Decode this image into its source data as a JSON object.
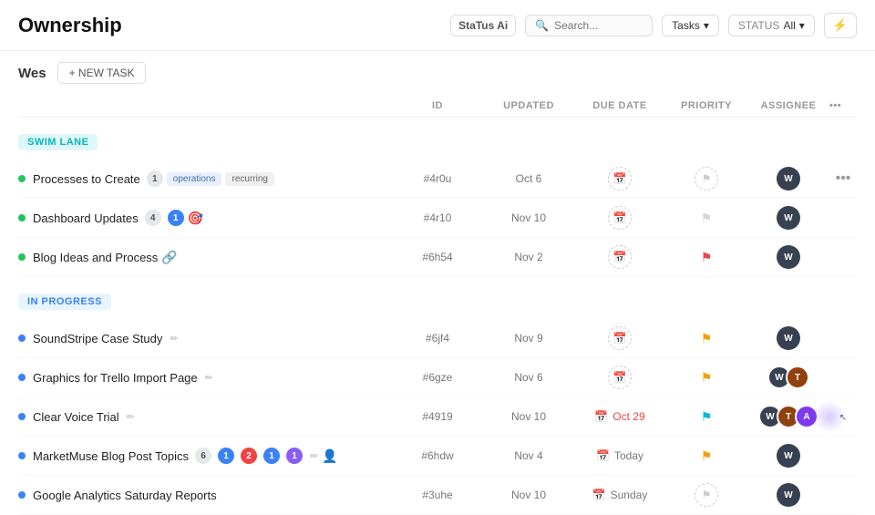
{
  "header": {
    "title": "Ownership",
    "search_placeholder": "Search...",
    "tasks_label": "Tasks",
    "status_label": "STATUS",
    "status_value": "All",
    "ai_label": "StaTus Ai"
  },
  "user": {
    "name": "Wes",
    "new_task_label": "+ NEW TASK"
  },
  "table": {
    "columns": [
      "",
      "ID",
      "UPDATED",
      "DUE DATE",
      "PRIORITY",
      "ASSIGNEE",
      "..."
    ]
  },
  "swim_lane": {
    "label": "SWIM LANE",
    "tasks": [
      {
        "name": "Processes to Create",
        "badge": "1",
        "badge_type": "gray",
        "tags": [
          "operations",
          "recurring"
        ],
        "id": "#4r0u",
        "updated": "Oct 6",
        "due_date": "",
        "priority": "none",
        "assignee": "dark"
      },
      {
        "name": "Dashboard Updates",
        "badge": "4",
        "badge_type": "gray",
        "badge2": "1",
        "badge2_type": "blue",
        "tags": [],
        "id": "#4r10",
        "updated": "Nov 10",
        "due_date": "",
        "priority": "none",
        "assignee": "dark"
      },
      {
        "name": "Blog Ideas and Process",
        "badge": "",
        "tags": [],
        "id": "#6h54",
        "updated": "Nov 2",
        "due_date": "",
        "priority": "red",
        "assignee": "dark"
      }
    ]
  },
  "in_progress": {
    "label": "IN PROGRESS",
    "tasks": [
      {
        "name": "SoundStripe Case Study",
        "edit": true,
        "id": "#6jf4",
        "updated": "Nov 9",
        "due_date": "",
        "priority": "yellow",
        "assignee": "single"
      },
      {
        "name": "Graphics for Trello Import Page",
        "edit": true,
        "id": "#6gze",
        "updated": "Nov 6",
        "due_date": "",
        "priority": "yellow",
        "assignee": "multi2"
      },
      {
        "name": "Clear Voice Trial",
        "edit": true,
        "id": "#4919",
        "updated": "Nov 10",
        "due_date": "Oct 29",
        "due_overdue": true,
        "priority": "cyan",
        "assignee": "multi3"
      },
      {
        "name": "MarketMuse Blog Post Topics",
        "badge": "6",
        "badge_type": "gray",
        "badges_extra": [
          "1b",
          "2r",
          "1b2",
          "1p"
        ],
        "edit": true,
        "has_avatar_extra": true,
        "id": "#6hdw",
        "updated": "Nov 4",
        "due_date": "Today",
        "priority": "yellow",
        "assignee": "single"
      },
      {
        "name": "Google Analytics Saturday Reports",
        "id": "#3uhe",
        "updated": "Nov 10",
        "due_date": "Sunday",
        "priority": "none_dashed",
        "assignee": "single"
      }
    ]
  }
}
